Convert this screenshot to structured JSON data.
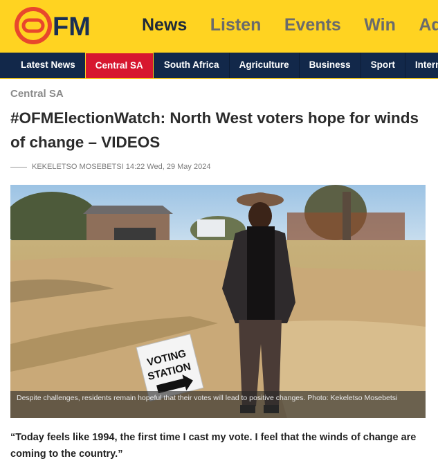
{
  "brand": {
    "logo_text": "OFM",
    "accent": "#ffd321",
    "navy": "#12284a",
    "red": "#d7172f"
  },
  "top_nav": {
    "items": [
      {
        "label": "News",
        "active": true
      },
      {
        "label": "Listen"
      },
      {
        "label": "Events"
      },
      {
        "label": "Win"
      },
      {
        "label": "Adv"
      }
    ]
  },
  "categories": {
    "items": [
      {
        "label": "Latest News"
      },
      {
        "label": "Central SA",
        "active": true
      },
      {
        "label": "South Africa"
      },
      {
        "label": "Agriculture"
      },
      {
        "label": "Business"
      },
      {
        "label": "Sport"
      },
      {
        "label": "Interna"
      }
    ]
  },
  "article": {
    "section": "Central SA",
    "headline": "#OFMElectionWatch: North West voters hope for winds of change – VIDEOS",
    "author": "KEKELETSO MOSEBETSI",
    "timestamp": "14:22 Wed, 29 May 2024",
    "photo": {
      "sign_text_line1": "VOTING",
      "sign_text_line2": "STATION",
      "caption": "Despite challenges, residents remain hopeful that their votes will lead to positive changes. Photo: Kekeletso Mosebetsi"
    },
    "quote": "“Today feels like 1994, the first time I cast my vote. I feel that the winds of change are coming to the country.”"
  }
}
